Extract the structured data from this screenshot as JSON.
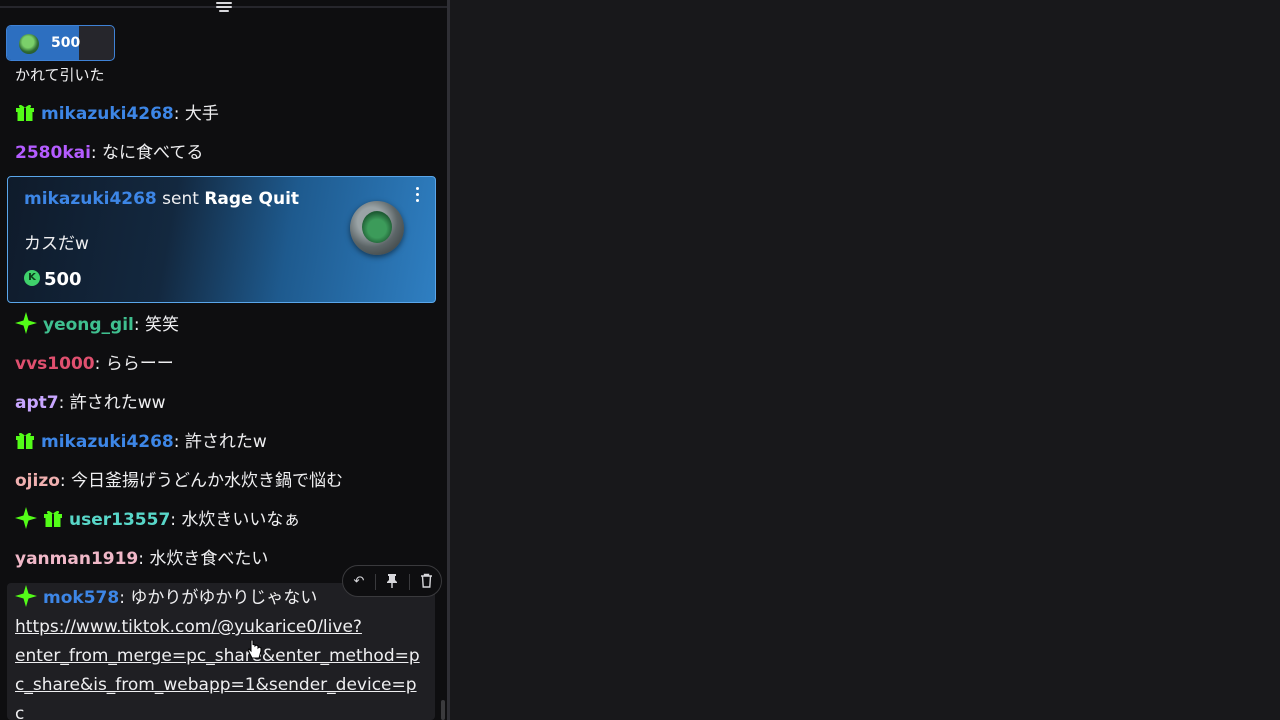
{
  "pinned_gift": {
    "amount": "500",
    "fill_fraction": 0.67,
    "icon": "rage-quit-gift-icon"
  },
  "partial_text": "かれて引いた",
  "messages": [
    {
      "badges": [
        "gift"
      ],
      "user": "mikazuki4268",
      "color": "#3d86e6",
      "text": ": 大手"
    },
    {
      "badges": [],
      "user": "2580kai",
      "color": "#b45cff",
      "text": ": なに食べてる"
    },
    {
      "badges": [
        "spark"
      ],
      "user": "yeong_gil",
      "color": "#3fbf8f",
      "text": ": 笑笑"
    },
    {
      "badges": [],
      "user": "vvs1000",
      "color": "#e0506f",
      "text": ": ららーー"
    },
    {
      "badges": [],
      "user": "apt7",
      "color": "#c8a6ff",
      "text": ": 許されたww"
    },
    {
      "badges": [
        "gift"
      ],
      "user": "mikazuki4268",
      "color": "#3d86e6",
      "text": ": 許されたw"
    },
    {
      "badges": [],
      "user": "ojizo",
      "color": "#f0b0b0",
      "text": ": 今日釜揚げうどんか水炊き鍋で悩む"
    },
    {
      "badges": [
        "spark",
        "gift"
      ],
      "user": "user13557",
      "color": "#58d6c8",
      "text": ": 水炊きいいなぁ"
    },
    {
      "badges": [],
      "user": "yanman1919",
      "color": "#f0b8c8",
      "text": ": 水炊き食べたい"
    }
  ],
  "gift_card": {
    "user": "mikazuki4268",
    "sent": " sent ",
    "gift_name": "Rage Quit",
    "message": "カスだw",
    "coin_symbol": "K",
    "amount": "500"
  },
  "hover_message": {
    "badges": [
      "spark"
    ],
    "user": "mok578",
    "color": "#3d86e6",
    "text": ": ゆかりがゆかりじゃない",
    "link_lines": [
      "https://www.tiktok.com/@yukarice0/live?",
      "enter_from_merge=pc_share&enter_method=p",
      "c_share&is_from_webapp=1&sender_device=p",
      "c"
    ]
  },
  "mod_toolbar": {
    "reply_icon": "↶",
    "pin_icon": "📌",
    "delete_icon": "🗑"
  },
  "colors": {
    "gift_badge": "#53fc18",
    "spark_badge": "#53fc18",
    "accent_blue": "#3f82d6"
  }
}
